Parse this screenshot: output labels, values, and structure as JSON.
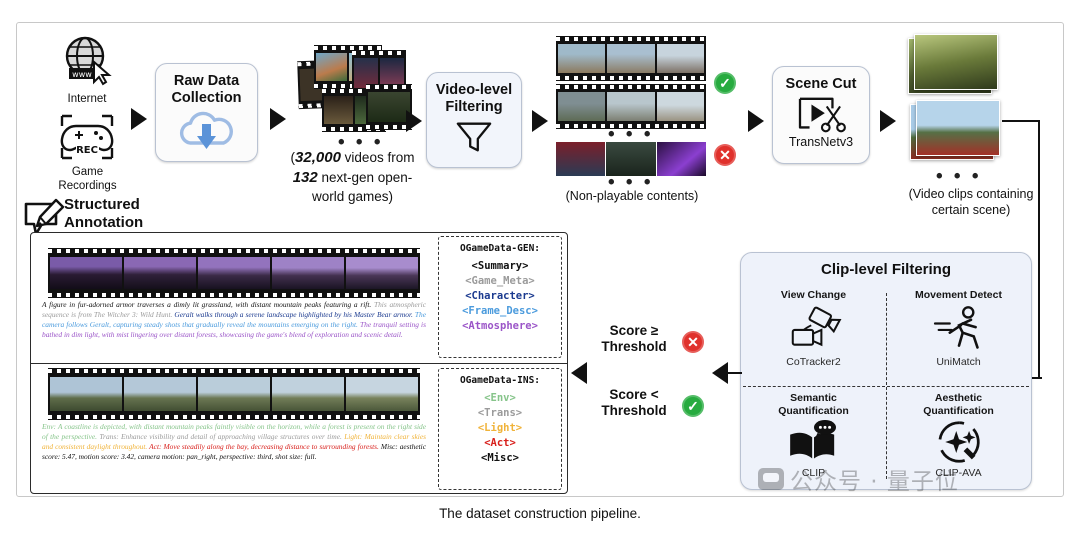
{
  "figure": {
    "caption": "The dataset construction pipeline.",
    "watermark": "公众号 · 量子位"
  },
  "sources": {
    "internet_label": "Internet",
    "internet_icon": "globe-www-cursor-icon",
    "game_label_line1": "Game",
    "game_label_line2": "Recordings",
    "game_icon": "gamepad-rec-icon"
  },
  "stages": {
    "raw_data_collection": {
      "title_line1": "Raw Data",
      "title_line2": "Collection",
      "icon": "cloud-download-icon"
    },
    "video_level_filtering": {
      "title_line1": "Video-level",
      "title_line2": "Filtering",
      "icon": "funnel-icon"
    },
    "scene_cut": {
      "title": "Scene Cut",
      "tool": "TransNetv3",
      "icon": "play-scissors-icon"
    },
    "structured_annotation": {
      "title_line1": "Structured",
      "title_line2": "Annotation",
      "icon": "pencil-note-icon"
    }
  },
  "dataset_stats": {
    "line1_pre": "(",
    "line1_num": "32,000",
    "line1_post": " videos from",
    "line2_num": "132",
    "line2_post": " next-gen open-",
    "line3": "world games)"
  },
  "filter_results": {
    "accepted_badge": "check-icon",
    "rejected_badge": "cross-icon",
    "rejected_caption": "(Non-playable contents)",
    "ellipsis": "• • •"
  },
  "scene_cut_output": {
    "caption_line1": "(Video clips containing",
    "caption_line2": "certain scene)",
    "ellipsis": "• • •"
  },
  "clip_filtering": {
    "title": "Clip-level Filtering",
    "quadrants": [
      {
        "title": "View Change",
        "title2": "",
        "tool": "CoTracker2",
        "icon": "camera-view-change-icon"
      },
      {
        "title": "Movement Detect",
        "title2": "",
        "tool": "UniMatch",
        "icon": "running-person-icon"
      },
      {
        "title": "Semantic",
        "title2": "Quantification",
        "tool": "CLIP",
        "icon": "open-book-chat-icon"
      },
      {
        "title": "Aesthetic",
        "title2": "Quantification",
        "tool": "CLIP-AVA",
        "icon": "sparkle-brush-icon"
      }
    ]
  },
  "thresholds": {
    "above": {
      "line1": "Score ≥",
      "line2": "Threshold",
      "badge": "cross-icon"
    },
    "below": {
      "line1": "Score <",
      "line2": "Threshold",
      "badge": "check-icon"
    }
  },
  "annotation_panel": {
    "gen": {
      "header": "OGameData-GEN:",
      "tags": [
        {
          "text": "<Summary>",
          "color": "#111111"
        },
        {
          "text": "<Game_Meta>",
          "color": "#9b9b9b"
        },
        {
          "text": "<Character>",
          "color": "#1b3a8f"
        },
        {
          "text": "<Frame_Desc>",
          "color": "#4b9bdd"
        },
        {
          "text": "<Atmosphere>",
          "color": "#9b55c8"
        }
      ]
    },
    "ins": {
      "header": "OGameData-INS:",
      "tags": [
        {
          "text": "<Env>",
          "color": "#86c48a"
        },
        {
          "text": "<Trans>",
          "color": "#9b9b9b"
        },
        {
          "text": "<Light>",
          "color": "#f0b33a"
        },
        {
          "text": "<Act>",
          "color": "#d8201c"
        },
        {
          "text": "<Misc>",
          "color": "#111111"
        }
      ]
    },
    "gen_text": [
      {
        "text": "A figure in fur-adorned armor traverses a dimly lit grassland, with distant mountain peaks featuring a rift. ",
        "color": "#111111"
      },
      {
        "text": "This atmospheric sequence is from The Witcher 3: Wild Hunt. ",
        "color": "#9b9b9b"
      },
      {
        "text": "Geralt walks through a serene landscape highlighted by his Master Bear armor. ",
        "color": "#1b3a8f"
      },
      {
        "text": "The camera follows Geralt, capturing steady shots that gradually reveal the mountains emerging on the right. ",
        "color": "#4b9bdd"
      },
      {
        "text": "The tranquil setting is bathed in dim light, with mist lingering over distant forests, showcasing the game's blend of exploration and scenic detail.",
        "color": "#9b55c8"
      }
    ],
    "ins_text": [
      {
        "text": "Env: A coastline is depicted, with distant mountain peaks faintly visible on the horizon, while a forest is present on the right side of the perspective. ",
        "color": "#86c48a"
      },
      {
        "text": "Trans: Enhance visibility and detail of approaching village structures over time. ",
        "color": "#9b9b9b"
      },
      {
        "text": "Light: Maintain clear skies and consistent daylight throughout. ",
        "color": "#f0b33a"
      },
      {
        "text": "Act: Move steadily along the bay, decreasing distance to surrounding forests. ",
        "color": "#d8201c"
      },
      {
        "text": "Misc: aesthetic score: 5.47, motion score: 3.42, camera motion: pan_right, perspective: third, shot size: full.",
        "color": "#111111"
      }
    ]
  }
}
